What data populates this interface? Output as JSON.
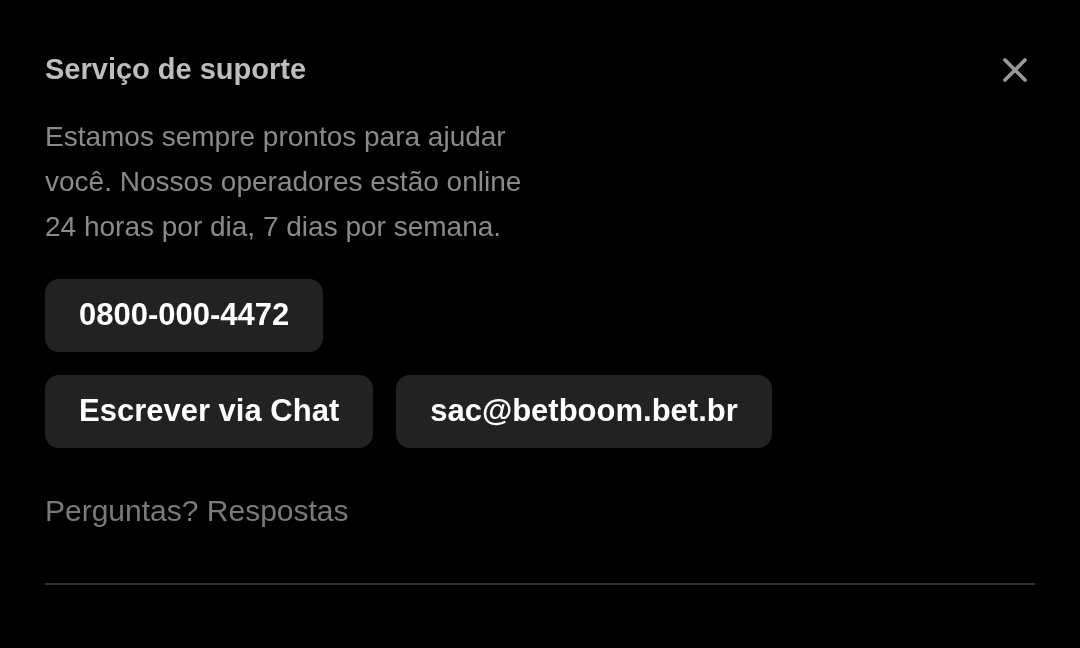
{
  "title": "Serviço de suporte",
  "description": "Estamos sempre prontos para ajudar você. Nossos operadores estão online 24 horas por dia, 7 dias por semana.",
  "contact_rows": [
    [
      "0800-000-4472"
    ],
    [
      "Escrever via Chat",
      "sac@betboom.bet.br"
    ]
  ],
  "faq_link": "Perguntas? Respostas"
}
